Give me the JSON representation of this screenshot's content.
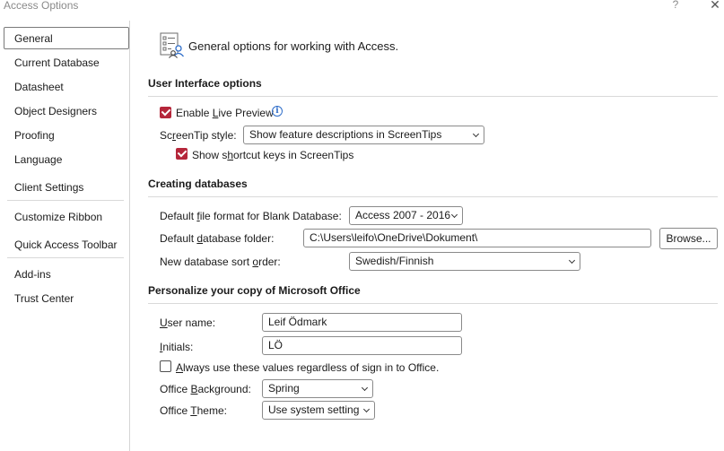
{
  "window": {
    "title": "Access Options",
    "help_label": "?",
    "close_label": "✕"
  },
  "sidebar": {
    "items": [
      {
        "label": "General"
      },
      {
        "label": "Current Database"
      },
      {
        "label": "Datasheet"
      },
      {
        "label": "Object Designers"
      },
      {
        "label": "Proofing"
      },
      {
        "label": "Language"
      },
      {
        "label": "Client Settings"
      },
      {
        "label": "Customize Ribbon"
      },
      {
        "label": "Quick Access Toolbar"
      },
      {
        "label": "Add-ins"
      },
      {
        "label": "Trust Center"
      }
    ],
    "selected": "General"
  },
  "header": {
    "text": "General options for working with Access.",
    "icon": "options-icon"
  },
  "ui_options": {
    "title": "User Interface options",
    "live_preview": {
      "label_pre": "Enable ",
      "label_mnemonic": "L",
      "label_post": "ive Preview",
      "checked": true
    },
    "info_glyph": "i",
    "screentip": {
      "label_pre": "Sc",
      "label_mnemonic": "r",
      "label_post": "eenTip style:",
      "value": "Show feature descriptions in ScreenTips"
    },
    "shortcut_keys": {
      "label_pre": "Show s",
      "label_mnemonic": "h",
      "label_post": "ortcut keys in ScreenTips",
      "checked": true
    }
  },
  "creating": {
    "title": "Creating databases",
    "file_format": {
      "label_pre": "Default ",
      "label_mnemonic": "f",
      "label_post": "ile format for Blank Database:",
      "value": "Access 2007 - 2016"
    },
    "folder": {
      "label_pre": "Default ",
      "label_mnemonic": "d",
      "label_post": "atabase folder:",
      "value": "C:\\Users\\leifo\\OneDrive\\Dokument\\"
    },
    "browse_label": "Browse...",
    "sort_order": {
      "label_pre": "New database sort ",
      "label_mnemonic": "o",
      "label_post": "rder:",
      "value": "Swedish/Finnish"
    }
  },
  "personalize": {
    "title": "Personalize your copy of Microsoft Office",
    "user_name": {
      "label_pre": "",
      "label_mnemonic": "U",
      "label_post": "ser name:",
      "value": "Leif Ödmark"
    },
    "initials": {
      "label_pre": "",
      "label_mnemonic": "I",
      "label_post": "nitials:",
      "value": "LÖ"
    },
    "always_use": {
      "label_pre": "",
      "label_mnemonic": "A",
      "label_post": "lways use these values regardless of sign in to Office.",
      "checked": false
    },
    "background": {
      "label_pre": "Office ",
      "label_mnemonic": "B",
      "label_post": "ackground:",
      "value": "Spring"
    },
    "theme": {
      "label_pre": "Office ",
      "label_mnemonic": "T",
      "label_post": "heme:",
      "value": "Use system setting"
    }
  },
  "colors": {
    "accent_checkbox": "#b5263a",
    "info_blue": "#2e6dc9"
  }
}
